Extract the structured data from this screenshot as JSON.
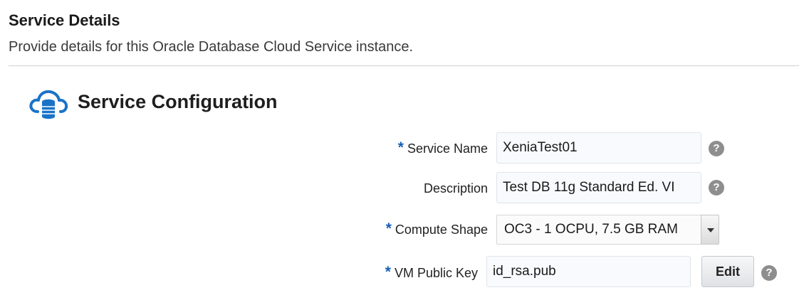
{
  "header": {
    "title": "Service Details",
    "subtitle": "Provide details for this Oracle Database Cloud Service instance."
  },
  "section": {
    "title": "Service Configuration",
    "icon": "cloud-database-icon",
    "icon_color": "#1a73c8"
  },
  "form": {
    "required_marker": "*",
    "required_color": "#1a5fb4",
    "service_name": {
      "label": "Service Name",
      "value": "XeniaTest01",
      "required": true,
      "help": "?"
    },
    "description": {
      "label": "Description",
      "value": "Test DB 11g Standard Ed. VI",
      "required": false,
      "help": "?"
    },
    "compute_shape": {
      "label": "Compute Shape",
      "value": "OC3 - 1 OCPU, 7.5 GB RAM",
      "required": true
    },
    "vm_public_key": {
      "label": "VM Public Key",
      "value": "id_rsa.pub",
      "required": true,
      "button": "Edit",
      "help": "?"
    }
  }
}
